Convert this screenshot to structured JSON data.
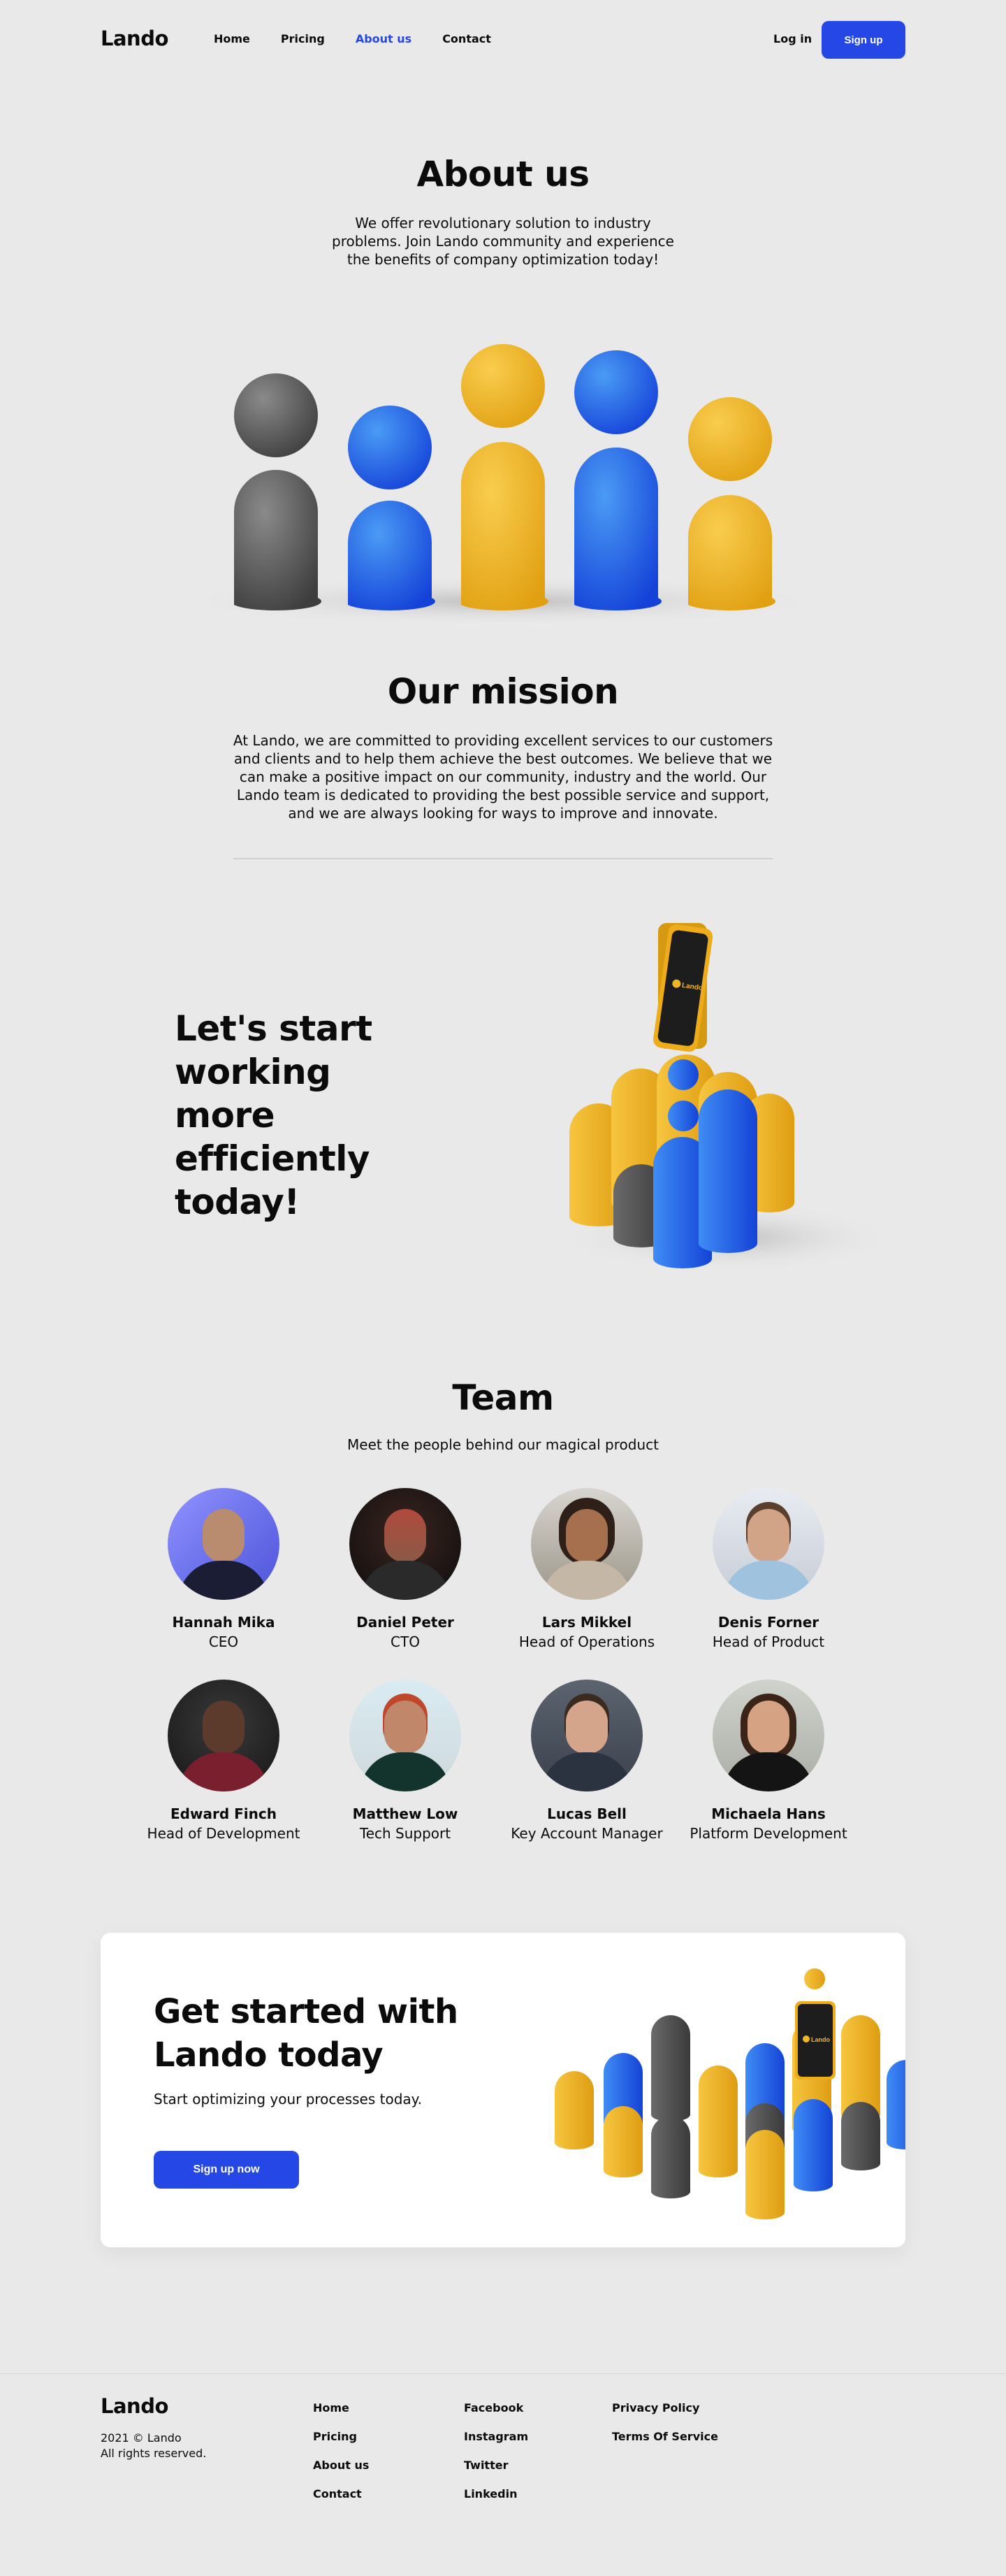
{
  "nav": {
    "logo": "Lando",
    "items": [
      {
        "label": "Home"
      },
      {
        "label": "Pricing"
      },
      {
        "label": "About us"
      },
      {
        "label": "Contact"
      }
    ],
    "login": "Log in",
    "signup": "Sign up",
    "accent": "#2547e6"
  },
  "about": {
    "title": "About us",
    "text": "We offer revolutionary solution to industry problems. Join Lando community and experience the benefits of company optimization today!"
  },
  "mission": {
    "title": "Our mission",
    "text": "At Lando, we are committed to providing excellent services to our customers and clients and to help them achieve the best outcomes. We believe that we can make a positive impact on our community, industry and the world. Our Lando team is dedicated to providing the best possible service and support, and we are always looking for ways to improve and innovate."
  },
  "cta": {
    "title": "Let's start working more efficiently today!",
    "phone_brand": "Lando"
  },
  "team": {
    "title": "Team",
    "subtitle": "Meet the people behind our magical product",
    "members": [
      {
        "name": "Hannah Mika",
        "role": "CEO"
      },
      {
        "name": "Daniel Peter",
        "role": "CTO"
      },
      {
        "name": "Lars Mikkel",
        "role": "Head of Operations"
      },
      {
        "name": "Denis Forner",
        "role": "Head of Product"
      },
      {
        "name": "Edward Finch",
        "role": "Head of Development"
      },
      {
        "name": "Matthew Low",
        "role": "Tech Support"
      },
      {
        "name": "Lucas Bell",
        "role": "Key Account Manager"
      },
      {
        "name": "Michaela Hans",
        "role": "Platform Development"
      }
    ]
  },
  "get_started": {
    "title": "Get started with Lando today",
    "text": "Start optimizing your processes today.",
    "button": "Sign up now",
    "phone_brand": "Lando"
  },
  "footer": {
    "logo": "Lando",
    "copyright": "2021 © Lando",
    "rights": "All rights reserved.",
    "col1": [
      "Home",
      "Pricing",
      "About us",
      "Contact"
    ],
    "col2": [
      "Facebook",
      "Instagram",
      "Twitter",
      "Linkedin"
    ],
    "col3": [
      "Privacy Policy",
      "Terms Of Service"
    ]
  },
  "colors": {
    "background": "#e9e9e9",
    "blue": "#2466ee",
    "yellow": "#f2b523",
    "gray": "#5a5a5a"
  }
}
